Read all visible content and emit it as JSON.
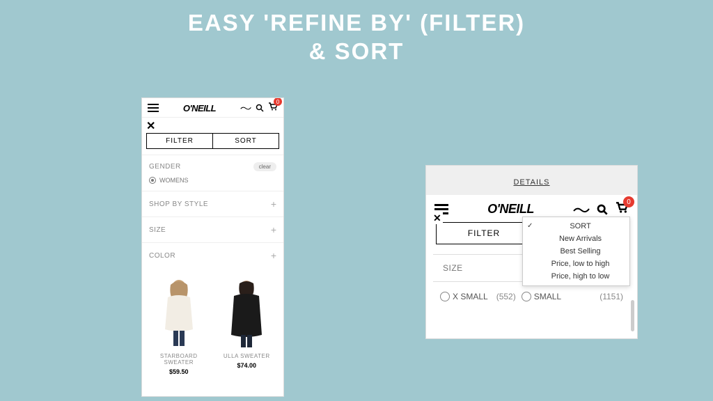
{
  "slide": {
    "title_line1": "EASY 'REFINE BY' (FILTER)",
    "title_line2": "& SORT"
  },
  "left": {
    "logo": "O'NEILL",
    "cart_count": "0",
    "tab_filter": "FILTER",
    "tab_sort": "SORT",
    "gender": {
      "label": "GENDER",
      "clear": "clear",
      "option": "WOMENS"
    },
    "style_label": "SHOP BY STYLE",
    "size_label": "SIZE",
    "color_label": "COLOR",
    "products": [
      {
        "name": "STARBOARD SWEATER",
        "price": "$59.50"
      },
      {
        "name": "ULLA SWEATER",
        "price": "$74.00"
      }
    ]
  },
  "right": {
    "details": "DETAILS",
    "logo": "O'NEILL",
    "cart_count": "0",
    "tab_filter": "FILTER",
    "sort": {
      "header": "SORT",
      "options": [
        "New Arrivals",
        "Best Selling",
        "Price, low to high",
        "Price, high to low"
      ]
    },
    "size_label": "SIZE",
    "sizes": [
      {
        "name": "X SMALL",
        "count": "(552)"
      },
      {
        "name": "SMALL",
        "count": "(1151)"
      }
    ]
  }
}
